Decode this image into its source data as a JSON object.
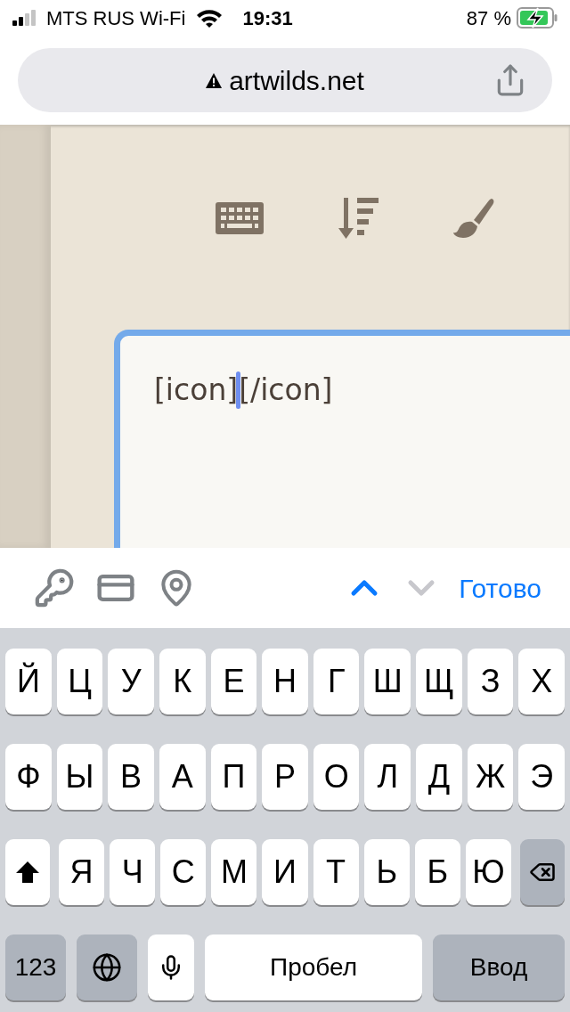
{
  "status_bar": {
    "carrier": "MTS RUS Wi-Fi",
    "time": "19:31",
    "battery": "87 %",
    "charging": true
  },
  "address_bar": {
    "url": "artwilds.net",
    "insecure": true
  },
  "toolbar": {
    "buttons": [
      {
        "kind": "keyboard"
      },
      {
        "kind": "sort"
      },
      {
        "kind": "brush"
      }
    ]
  },
  "editor": {
    "text_before_caret": "[icon]",
    "text_after_caret": "[/icon]",
    "focused": true
  },
  "accessory_bar": {
    "autofill": [
      {
        "kind": "key"
      },
      {
        "kind": "card"
      },
      {
        "kind": "pin"
      }
    ],
    "previous": {
      "disabled": false
    },
    "next": {
      "disabled": true
    },
    "done": "Готово"
  },
  "keyboard": {
    "rows": [
      [
        {
          "kind": "letter",
          "label": "Й"
        },
        {
          "kind": "letter",
          "label": "Ц"
        },
        {
          "kind": "letter",
          "label": "У"
        },
        {
          "kind": "letter",
          "label": "К"
        },
        {
          "kind": "letter",
          "label": "Е"
        },
        {
          "kind": "letter",
          "label": "Н"
        },
        {
          "kind": "letter",
          "label": "Г"
        },
        {
          "kind": "letter",
          "label": "Ш"
        },
        {
          "kind": "letter",
          "label": "Щ"
        },
        {
          "kind": "letter",
          "label": "З"
        },
        {
          "kind": "letter",
          "label": "Х"
        }
      ],
      [
        {
          "kind": "letter",
          "label": "Ф"
        },
        {
          "kind": "letter",
          "label": "Ы"
        },
        {
          "kind": "letter",
          "label": "В"
        },
        {
          "kind": "letter",
          "label": "А"
        },
        {
          "kind": "letter",
          "label": "П"
        },
        {
          "kind": "letter",
          "label": "Р"
        },
        {
          "kind": "letter",
          "label": "О"
        },
        {
          "kind": "letter",
          "label": "Л"
        },
        {
          "kind": "letter",
          "label": "Д"
        },
        {
          "kind": "letter",
          "label": "Ж"
        },
        {
          "kind": "letter",
          "label": "Э"
        }
      ],
      [
        {
          "kind": "shift"
        },
        {
          "kind": "letter",
          "label": "Я"
        },
        {
          "kind": "letter",
          "label": "Ч"
        },
        {
          "kind": "letter",
          "label": "С"
        },
        {
          "kind": "letter",
          "label": "М"
        },
        {
          "kind": "letter",
          "label": "И"
        },
        {
          "kind": "letter",
          "label": "Т"
        },
        {
          "kind": "letter",
          "label": "Ь"
        },
        {
          "kind": "letter",
          "label": "Б"
        },
        {
          "kind": "letter",
          "label": "Ю"
        },
        {
          "kind": "backspace"
        }
      ]
    ],
    "bottom_row": [
      {
        "kind": "mode",
        "label": "123"
      },
      {
        "kind": "globe"
      },
      {
        "kind": "mic"
      },
      {
        "kind": "space",
        "label": "Пробел"
      },
      {
        "kind": "return",
        "label": "Ввод"
      }
    ]
  }
}
